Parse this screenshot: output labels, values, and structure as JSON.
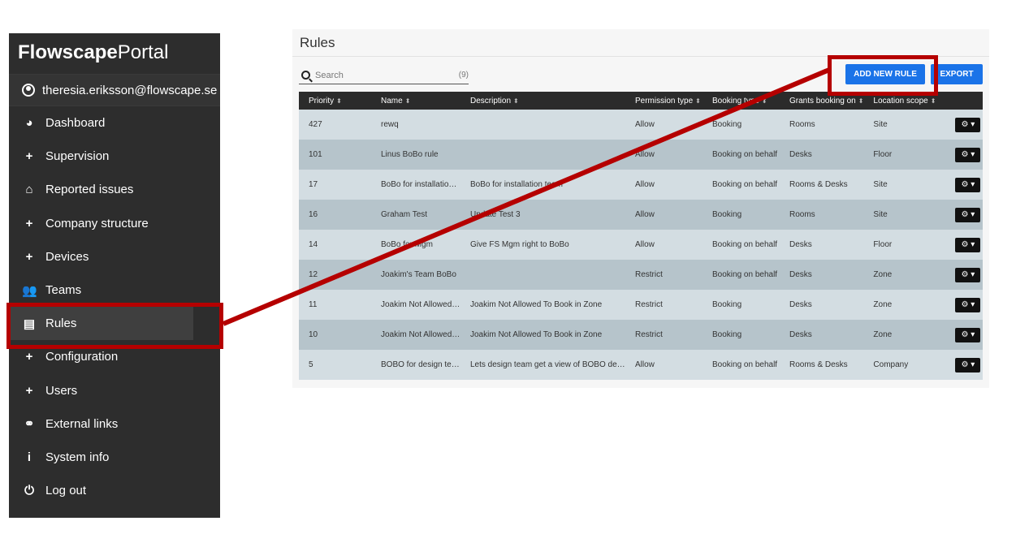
{
  "sidebar": {
    "brand_bold": "Flowscape",
    "brand_light": "Portal",
    "user_email": "theresia.eriksson@flowscape.se",
    "items": [
      {
        "label": "Dashboard",
        "icon": "dashboard-icon",
        "glyph": "◕"
      },
      {
        "label": "Supervision",
        "icon": "plus-icon",
        "glyph": "+"
      },
      {
        "label": "Reported issues",
        "icon": "home-icon",
        "glyph": "⌂"
      },
      {
        "label": "Company structure",
        "icon": "plus-icon",
        "glyph": "+"
      },
      {
        "label": "Devices",
        "icon": "plus-icon",
        "glyph": "+"
      },
      {
        "label": "Teams",
        "icon": "users-icon",
        "glyph": "👥"
      },
      {
        "label": "Rules",
        "icon": "file-icon",
        "glyph": "▤"
      },
      {
        "label": "Configuration",
        "icon": "plus-icon",
        "glyph": "+"
      },
      {
        "label": "Users",
        "icon": "plus-icon",
        "glyph": "+"
      },
      {
        "label": "External links",
        "icon": "link-icon",
        "glyph": "⚭"
      },
      {
        "label": "System info",
        "icon": "info-icon",
        "glyph": "i"
      },
      {
        "label": "Log out",
        "icon": "power-icon",
        "glyph": "⏻"
      }
    ],
    "active_item": "Rules"
  },
  "main": {
    "title": "Rules",
    "search_placeholder": "Search",
    "search_count": "(9)",
    "add_button": "ADD NEW RULE",
    "export_button": "EXPORT",
    "columns": [
      "Priority",
      "Name",
      "Description",
      "Permission type",
      "Booking type",
      "Grants booking on",
      "Location scope"
    ],
    "rows": [
      [
        "427",
        "rewq",
        "",
        "Allow",
        "Booking",
        "Rooms",
        "Site"
      ],
      [
        "101",
        "Linus BoBo rule",
        "",
        "Allow",
        "Booking on behalf",
        "Desks",
        "Floor"
      ],
      [
        "17",
        "BoBo for installation ...",
        "BoBo for installation team",
        "Allow",
        "Booking on behalf",
        "Rooms & Desks",
        "Site"
      ],
      [
        "16",
        "Graham Test",
        "Update Test 3",
        "Allow",
        "Booking",
        "Rooms",
        "Site"
      ],
      [
        "14",
        "BoBo for Mgm",
        "Give FS Mgm right to BoBo",
        "Allow",
        "Booking on behalf",
        "Desks",
        "Floor"
      ],
      [
        "12",
        "Joakim's Team BoBo",
        "",
        "Restrict",
        "Booking on behalf",
        "Desks",
        "Zone"
      ],
      [
        "11",
        "Joakim Not Allowed ...",
        "Joakim Not Allowed To Book in Zone",
        "Restrict",
        "Booking",
        "Desks",
        "Zone"
      ],
      [
        "10",
        "Joakim Not Allowed ...",
        "Joakim Not Allowed To Book in Zone",
        "Restrict",
        "Booking",
        "Desks",
        "Zone"
      ],
      [
        "5",
        "BOBO for design team",
        "Lets design team get a view of BOBO design",
        "Allow",
        "Booking on behalf",
        "Rooms & Desks",
        "Company"
      ]
    ]
  },
  "colors": {
    "sidebar_bg": "#2d2d2d",
    "accent_blue": "#1a73e8",
    "highlight_red": "#b50000",
    "row_light": "#d3dde2",
    "row_dark": "#b6c4cb"
  }
}
